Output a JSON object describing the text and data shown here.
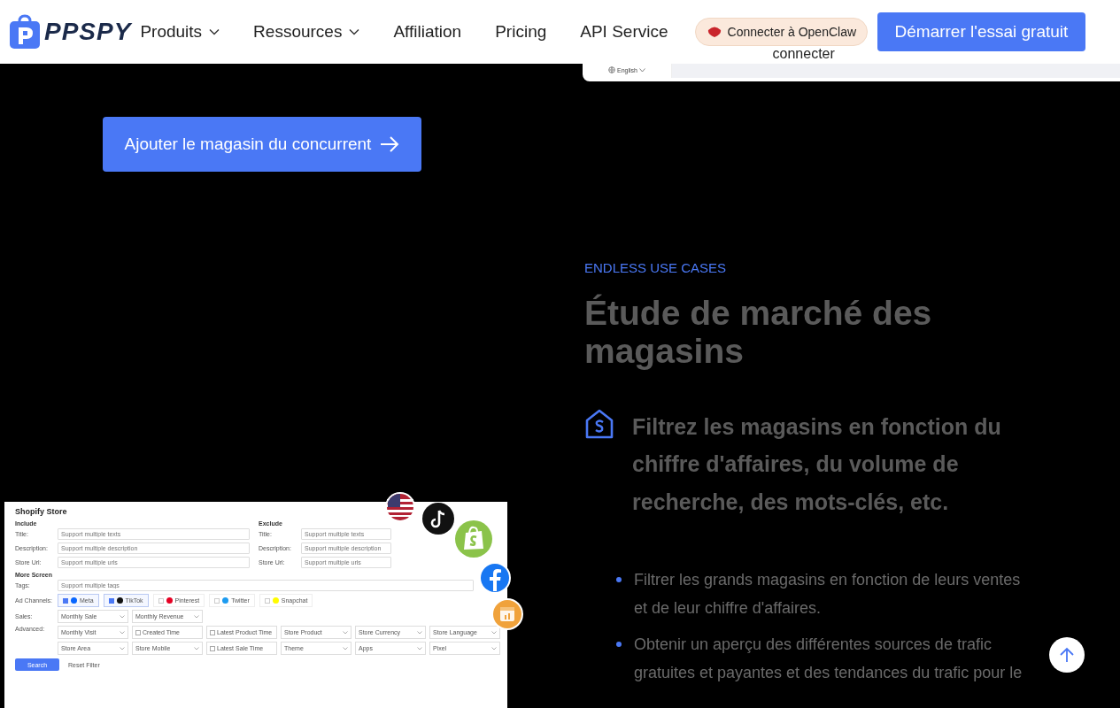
{
  "header": {
    "logo": "PPSPY",
    "nav": [
      {
        "label": "Produits",
        "dropdown": true
      },
      {
        "label": "Ressources",
        "dropdown": true
      },
      {
        "label": "Affiliation",
        "dropdown": false
      },
      {
        "label": "Pricing",
        "dropdown": false
      },
      {
        "label": "API Service",
        "dropdown": false
      }
    ],
    "login": "connecter",
    "openclaw": "Connecter à OpenClaw",
    "cta": "Démarrer l'essai gratuit"
  },
  "top_panel": {
    "language": "English"
  },
  "add_button": "Ajouter le magasin du concurrent",
  "store_screenshot": {
    "title": "Shopify Store",
    "include": {
      "heading": "Include",
      "fields": [
        {
          "label": "Title:",
          "placeholder": "Support multiple texts"
        },
        {
          "label": "Description:",
          "placeholder": "Support multiple description"
        },
        {
          "label": "Store Url:",
          "placeholder": "Support multiple urls"
        }
      ]
    },
    "exclude": {
      "heading": "Exclude",
      "fields": [
        {
          "label": "Title:",
          "placeholder": "Support multiple texts"
        },
        {
          "label": "Description:",
          "placeholder": "Support multiple description"
        },
        {
          "label": "Store Url:",
          "placeholder": "Support multiple urls"
        }
      ]
    },
    "more_heading": "More Screen",
    "tags_label": "Tags:",
    "tags_placeholder": "Support multiple tags",
    "channels_label": "Ad Channels:",
    "channels": [
      {
        "name": "Meta",
        "checked": true,
        "color": "#0866ff"
      },
      {
        "name": "TikTok",
        "checked": true,
        "color": "#111111"
      },
      {
        "name": "Pinterest",
        "checked": false,
        "color": "#e60023"
      },
      {
        "name": "Twitter",
        "checked": false,
        "color": "#1d9bf0"
      },
      {
        "name": "Snapchat",
        "checked": false,
        "color": "#fffc00"
      }
    ],
    "sales_label": "Sales:",
    "sales": [
      {
        "text": "Monthly Sale",
        "kind": "select"
      },
      {
        "text": "Monthly Revenue",
        "kind": "select"
      }
    ],
    "advanced_label": "Advanced:",
    "advanced": [
      {
        "text": "Monthly Visit",
        "kind": "select"
      },
      {
        "text": "Created Time",
        "kind": "date"
      },
      {
        "text": "Latest Product Time",
        "kind": "date"
      },
      {
        "text": "Store Product",
        "kind": "select"
      },
      {
        "text": "Store Currency",
        "kind": "select"
      },
      {
        "text": "Store Language",
        "kind": "select"
      },
      {
        "text": "Store Area",
        "kind": "select"
      },
      {
        "text": "Store Mobile",
        "kind": "select"
      },
      {
        "text": "Latest Sale Time",
        "kind": "date"
      },
      {
        "text": "Theme",
        "kind": "select"
      },
      {
        "text": "Apps",
        "kind": "select"
      },
      {
        "text": "Pixel",
        "kind": "select"
      }
    ],
    "search": "Search",
    "reset": "Reset Filter"
  },
  "section": {
    "eyebrow": "ENDLESS USE CASES",
    "title": "Étude de marché des magasins",
    "feature": "Filtrez les magasins en fonction du chiffre d'affaires, du volume de recherche, des mots-clés, etc.",
    "bullets": [
      "Filtrer les grands magasins en fonction de leurs ventes et de leur chiffre d'affaires.",
      "Obtenir un aperçu des différentes sources de trafic gratuites et payantes et des tendances du trafic pour le"
    ]
  }
}
